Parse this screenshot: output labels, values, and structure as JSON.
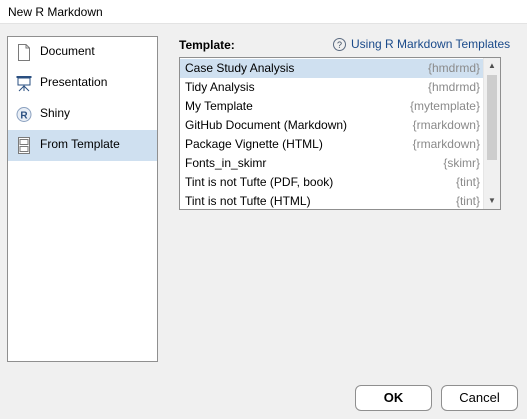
{
  "window": {
    "title": "New R Markdown"
  },
  "sidebar": {
    "items": [
      {
        "label": "Document",
        "icon": "document-icon",
        "selected": false
      },
      {
        "label": "Presentation",
        "icon": "presentation-icon",
        "selected": false
      },
      {
        "label": "Shiny",
        "icon": "shiny-r-icon",
        "selected": false
      },
      {
        "label": "From Template",
        "icon": "template-icon",
        "selected": true
      }
    ]
  },
  "main": {
    "template_label": "Template:",
    "help_link": {
      "icon": "help-icon",
      "glyph": "?",
      "label": "Using R Markdown Templates"
    },
    "templates": [
      {
        "name": "Case Study Analysis",
        "package": "{hmdrmd}",
        "selected": true
      },
      {
        "name": "Tidy Analysis",
        "package": "{hmdrmd}",
        "selected": false
      },
      {
        "name": "My Template",
        "package": "{mytemplate}",
        "selected": false
      },
      {
        "name": "GitHub Document (Markdown)",
        "package": "{rmarkdown}",
        "selected": false
      },
      {
        "name": "Package Vignette (HTML)",
        "package": "{rmarkdown}",
        "selected": false
      },
      {
        "name": "Fonts_in_skimr",
        "package": "{skimr}",
        "selected": false
      },
      {
        "name": "Tint is not Tufte (PDF, book)",
        "package": "{tint}",
        "selected": false
      },
      {
        "name": "Tint is not Tufte (HTML)",
        "package": "{tint}",
        "selected": false
      }
    ]
  },
  "footer": {
    "ok_label": "OK",
    "cancel_label": "Cancel"
  },
  "colors": {
    "selection": "#cfe0f0",
    "link": "#1a4a8a",
    "package_text": "#8a8a8a"
  }
}
